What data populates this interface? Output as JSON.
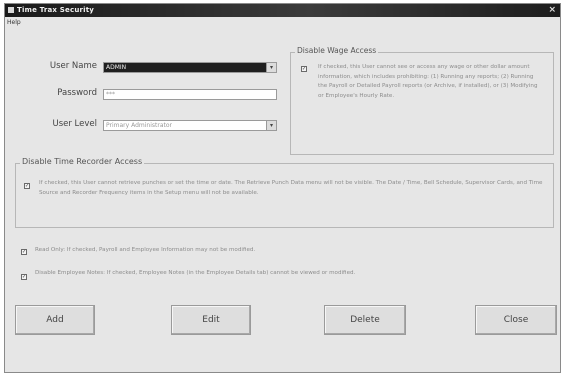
{
  "window": {
    "title": "Time Trax Security",
    "close_glyph": "×"
  },
  "menu": {
    "help": "Help"
  },
  "form": {
    "user_name_label": "User Name",
    "user_name_value": "ADMIN",
    "password_label": "Password",
    "password_value": "***",
    "user_level_label": "User Level",
    "user_level_value": "Primary Administrator",
    "dropdown_glyph": "▾"
  },
  "wage_group": {
    "title": "Disable Wage Access",
    "text": "If checked, this User cannot see or access any wage or other dollar amount information, which includes prohibiting: (1) Running any reports; (2) Running the Payroll or Detailed Payroll reports (or Archive, if installed), or (3) Modifying or Employee's Hourly Rate."
  },
  "time_group": {
    "title": "Disable Time Recorder Access",
    "text": "If checked, this User cannot retrieve punches or set the time or date. The Retrieve Punch Data menu will not be visible. The Date / Time, Bell Schedule, Supervisor Cards, and Time Source and Recorder Frequency items in the Setup menu will not be available."
  },
  "read_only": {
    "text": "Read Only: If checked, Payroll and Employee Information may not be modified."
  },
  "notes": {
    "text": "Disable Employee Notes: If checked, Employee Notes (in the Employee Details tab) cannot be viewed or modified."
  },
  "checkmark": "✓",
  "buttons": {
    "add": "Add",
    "edit": "Edit",
    "delete": "Delete",
    "close": "Close"
  },
  "icons": {
    "app": "window-icon",
    "dropdown": "chevron-down-icon"
  },
  "colors": {
    "titlebar": "#1a1a1a",
    "window_bg": "#e6e6e6",
    "selected_field": "#1f1f1f"
  }
}
